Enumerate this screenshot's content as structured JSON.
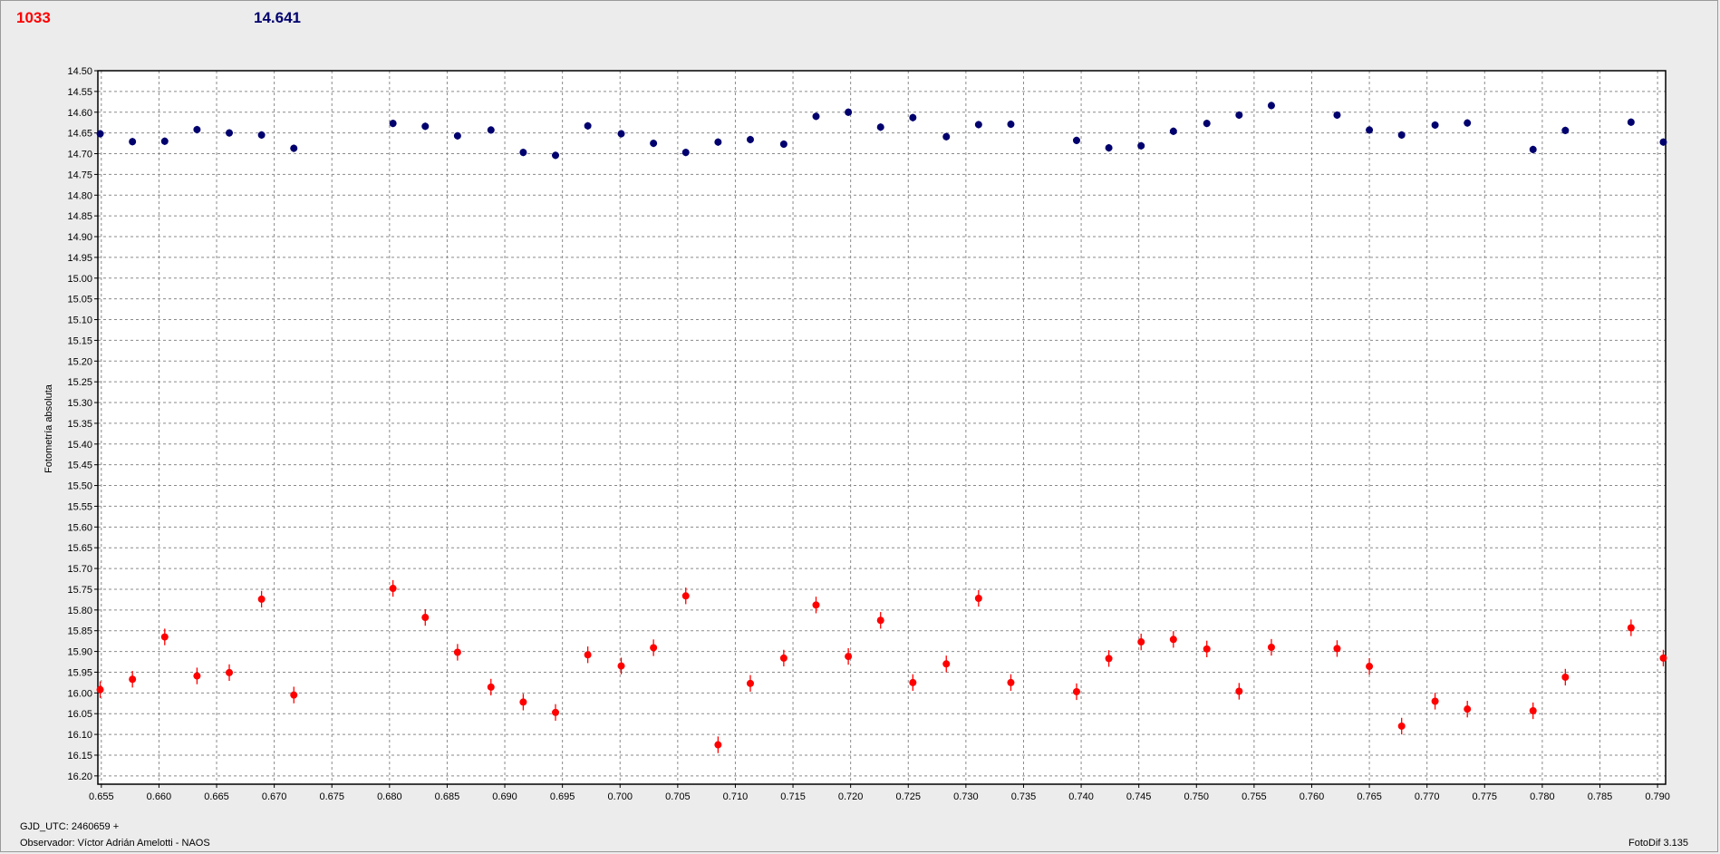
{
  "header": {
    "left_value": "1033",
    "right_value": "14.641"
  },
  "footer": {
    "gjd_label": "GJD_UTC: 2460659 +",
    "observer_label": "Observador: Víctor Adrián Amelotti - NAOS",
    "version_label": "FotoDif 3.135"
  },
  "colors": {
    "red_series": "#ff0000",
    "blue_series": "#00006e",
    "background": "#ececec",
    "plot_background": "#ffffff"
  },
  "chart_data": {
    "type": "scatter",
    "title": "",
    "xlabel": "",
    "ylabel": "Fotometría absoluta",
    "xlim": [
      0.6547,
      0.7907
    ],
    "ylim": [
      14.5,
      16.22
    ],
    "y_inverted": true,
    "grid": true,
    "x_ticks": [
      "0.655",
      "0.660",
      "0.665",
      "0.670",
      "0.675",
      "0.680",
      "0.685",
      "0.690",
      "0.695",
      "0.700",
      "0.705",
      "0.710",
      "0.715",
      "0.720",
      "0.725",
      "0.730",
      "0.735",
      "0.740",
      "0.745",
      "0.750",
      "0.755",
      "0.760",
      "0.765",
      "0.770",
      "0.775",
      "0.780",
      "0.785",
      "0.790"
    ],
    "y_ticks": [
      "14.50",
      "14.55",
      "14.60",
      "14.65",
      "14.70",
      "14.75",
      "14.80",
      "14.85",
      "14.90",
      "14.95",
      "15.00",
      "15.05",
      "15.10",
      "15.15",
      "15.20",
      "15.25",
      "15.30",
      "15.35",
      "15.40",
      "15.45",
      "15.50",
      "15.55",
      "15.60",
      "15.65",
      "15.70",
      "15.75",
      "15.80",
      "15.85",
      "15.90",
      "15.95",
      "16.00",
      "16.05",
      "16.10",
      "16.15",
      "16.20"
    ],
    "series": [
      {
        "color": "#00006e",
        "x": [
          0.6549,
          0.6577,
          0.6605,
          0.6633,
          0.6661,
          0.6689,
          0.6717,
          0.6803,
          0.6831,
          0.6859,
          0.6888,
          0.6916,
          0.6944,
          0.6972,
          0.7001,
          0.7029,
          0.7057,
          0.7085,
          0.7113,
          0.7142,
          0.717,
          0.7198,
          0.7226,
          0.7254,
          0.7283,
          0.7311,
          0.7339,
          0.7396,
          0.7424,
          0.7452,
          0.748,
          0.7509,
          0.7537,
          0.7565,
          0.7622,
          0.765,
          0.7678,
          0.7707,
          0.7735,
          0.7792,
          0.782,
          0.7877,
          0.7905
        ],
        "y": [
          14.652,
          14.671,
          14.67,
          14.642,
          14.65,
          14.655,
          14.687,
          14.627,
          14.634,
          14.657,
          14.643,
          14.697,
          14.704,
          14.633,
          14.652,
          14.675,
          14.697,
          14.672,
          14.666,
          14.677,
          14.61,
          14.6,
          14.636,
          14.613,
          14.659,
          14.63,
          14.629,
          14.668,
          14.686,
          14.681,
          14.646,
          14.627,
          14.607,
          14.584,
          14.607,
          14.643,
          14.655,
          14.631,
          14.626,
          14.69,
          14.644,
          14.624,
          14.672
        ],
        "error": 0.009
      },
      {
        "color": "#ff0000",
        "x": [
          0.6549,
          0.6577,
          0.6605,
          0.6633,
          0.6661,
          0.6689,
          0.6717,
          0.6803,
          0.6831,
          0.6859,
          0.6888,
          0.6916,
          0.6944,
          0.6972,
          0.7001,
          0.7029,
          0.7057,
          0.7085,
          0.7113,
          0.7142,
          0.717,
          0.7198,
          0.7226,
          0.7254,
          0.7283,
          0.7311,
          0.7339,
          0.7396,
          0.7424,
          0.7452,
          0.748,
          0.7509,
          0.7537,
          0.7565,
          0.7622,
          0.765,
          0.7678,
          0.7707,
          0.7735,
          0.7792,
          0.782,
          0.7877,
          0.7905
        ],
        "y": [
          15.992,
          15.967,
          15.865,
          15.959,
          15.951,
          15.774,
          16.005,
          15.748,
          15.818,
          15.902,
          15.986,
          16.022,
          16.047,
          15.908,
          15.935,
          15.891,
          15.766,
          16.125,
          15.977,
          15.916,
          15.788,
          15.912,
          15.825,
          15.975,
          15.93,
          15.772,
          15.975,
          15.997,
          15.917,
          15.877,
          15.871,
          15.894,
          15.996,
          15.89,
          15.893,
          15.936,
          16.08,
          16.02,
          16.039,
          16.043,
          15.962,
          15.843,
          15.916
        ],
        "error": 0.02
      }
    ]
  }
}
